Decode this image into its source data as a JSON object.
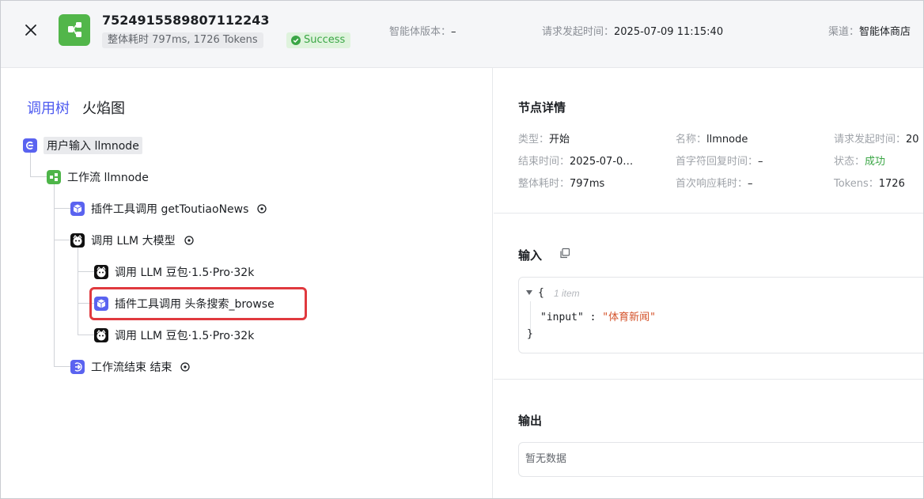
{
  "header": {
    "trace_id": "7524915589807112243",
    "summary": "整体耗时 797ms, 1726 Tokens",
    "status": "Success",
    "version_label": "智能体版本：",
    "version_value": "–",
    "request_time_label": "请求发起时间：",
    "request_time_value": "2025-07-09 11:15:40",
    "channel_label": "渠道：",
    "channel_value": "智能体商店"
  },
  "tabs": [
    {
      "label": "调用树",
      "active": true
    },
    {
      "label": "火焰图",
      "active": false
    }
  ],
  "tree": [
    {
      "label": "用户输入 llmnode",
      "icon": "user-input-icon"
    },
    {
      "label": "工作流 llmnode",
      "icon": "workflow-icon"
    },
    {
      "label": "插件工具调用 getToutiaoNews",
      "icon": "plugin-cube-icon"
    },
    {
      "label": "调用 LLM 大模型",
      "icon": "llm-avatar-icon"
    },
    {
      "label": "调用 LLM 豆包·1.5·Pro·32k",
      "icon": "llm-avatar-icon"
    },
    {
      "label": "插件工具调用 头条搜索_browse",
      "icon": "plugin-cube-icon",
      "highlighted": true
    },
    {
      "label": "调用 LLM 豆包·1.5·Pro·32k",
      "icon": "llm-avatar-icon"
    },
    {
      "label": "工作流结束 结束",
      "icon": "workflow-end-icon"
    }
  ],
  "detail": {
    "title": "节点详情",
    "type_label": "类型：",
    "type_value": "开始",
    "name_label": "名称：",
    "name_value": "llmnode",
    "req_label": "请求发起时间：",
    "req_value": "20",
    "end_label": "结束时间：",
    "end_value": "2025-07-0…",
    "first_label": "首字符回复时间：",
    "first_value": "–",
    "status_label": "状态：",
    "status_value": "成功",
    "total_label": "整体耗时：",
    "total_value": "797ms",
    "firstresp_label": "首次响应耗时：",
    "firstresp_value": "–",
    "tokens_label": "Tokens：",
    "tokens_value": "1726"
  },
  "input": {
    "title": "输入",
    "open_brace": "{",
    "count": "1 item",
    "key": "\"input\"",
    "colon": " : ",
    "value": "\"体育新闻\"",
    "close_brace": "}"
  },
  "output": {
    "title": "输出",
    "empty": "暂无数据"
  },
  "colors": {
    "accent": "#4e5bf0",
    "success": "#3aa645",
    "highlight_border": "#e0393e",
    "json_string": "#d4532b"
  }
}
